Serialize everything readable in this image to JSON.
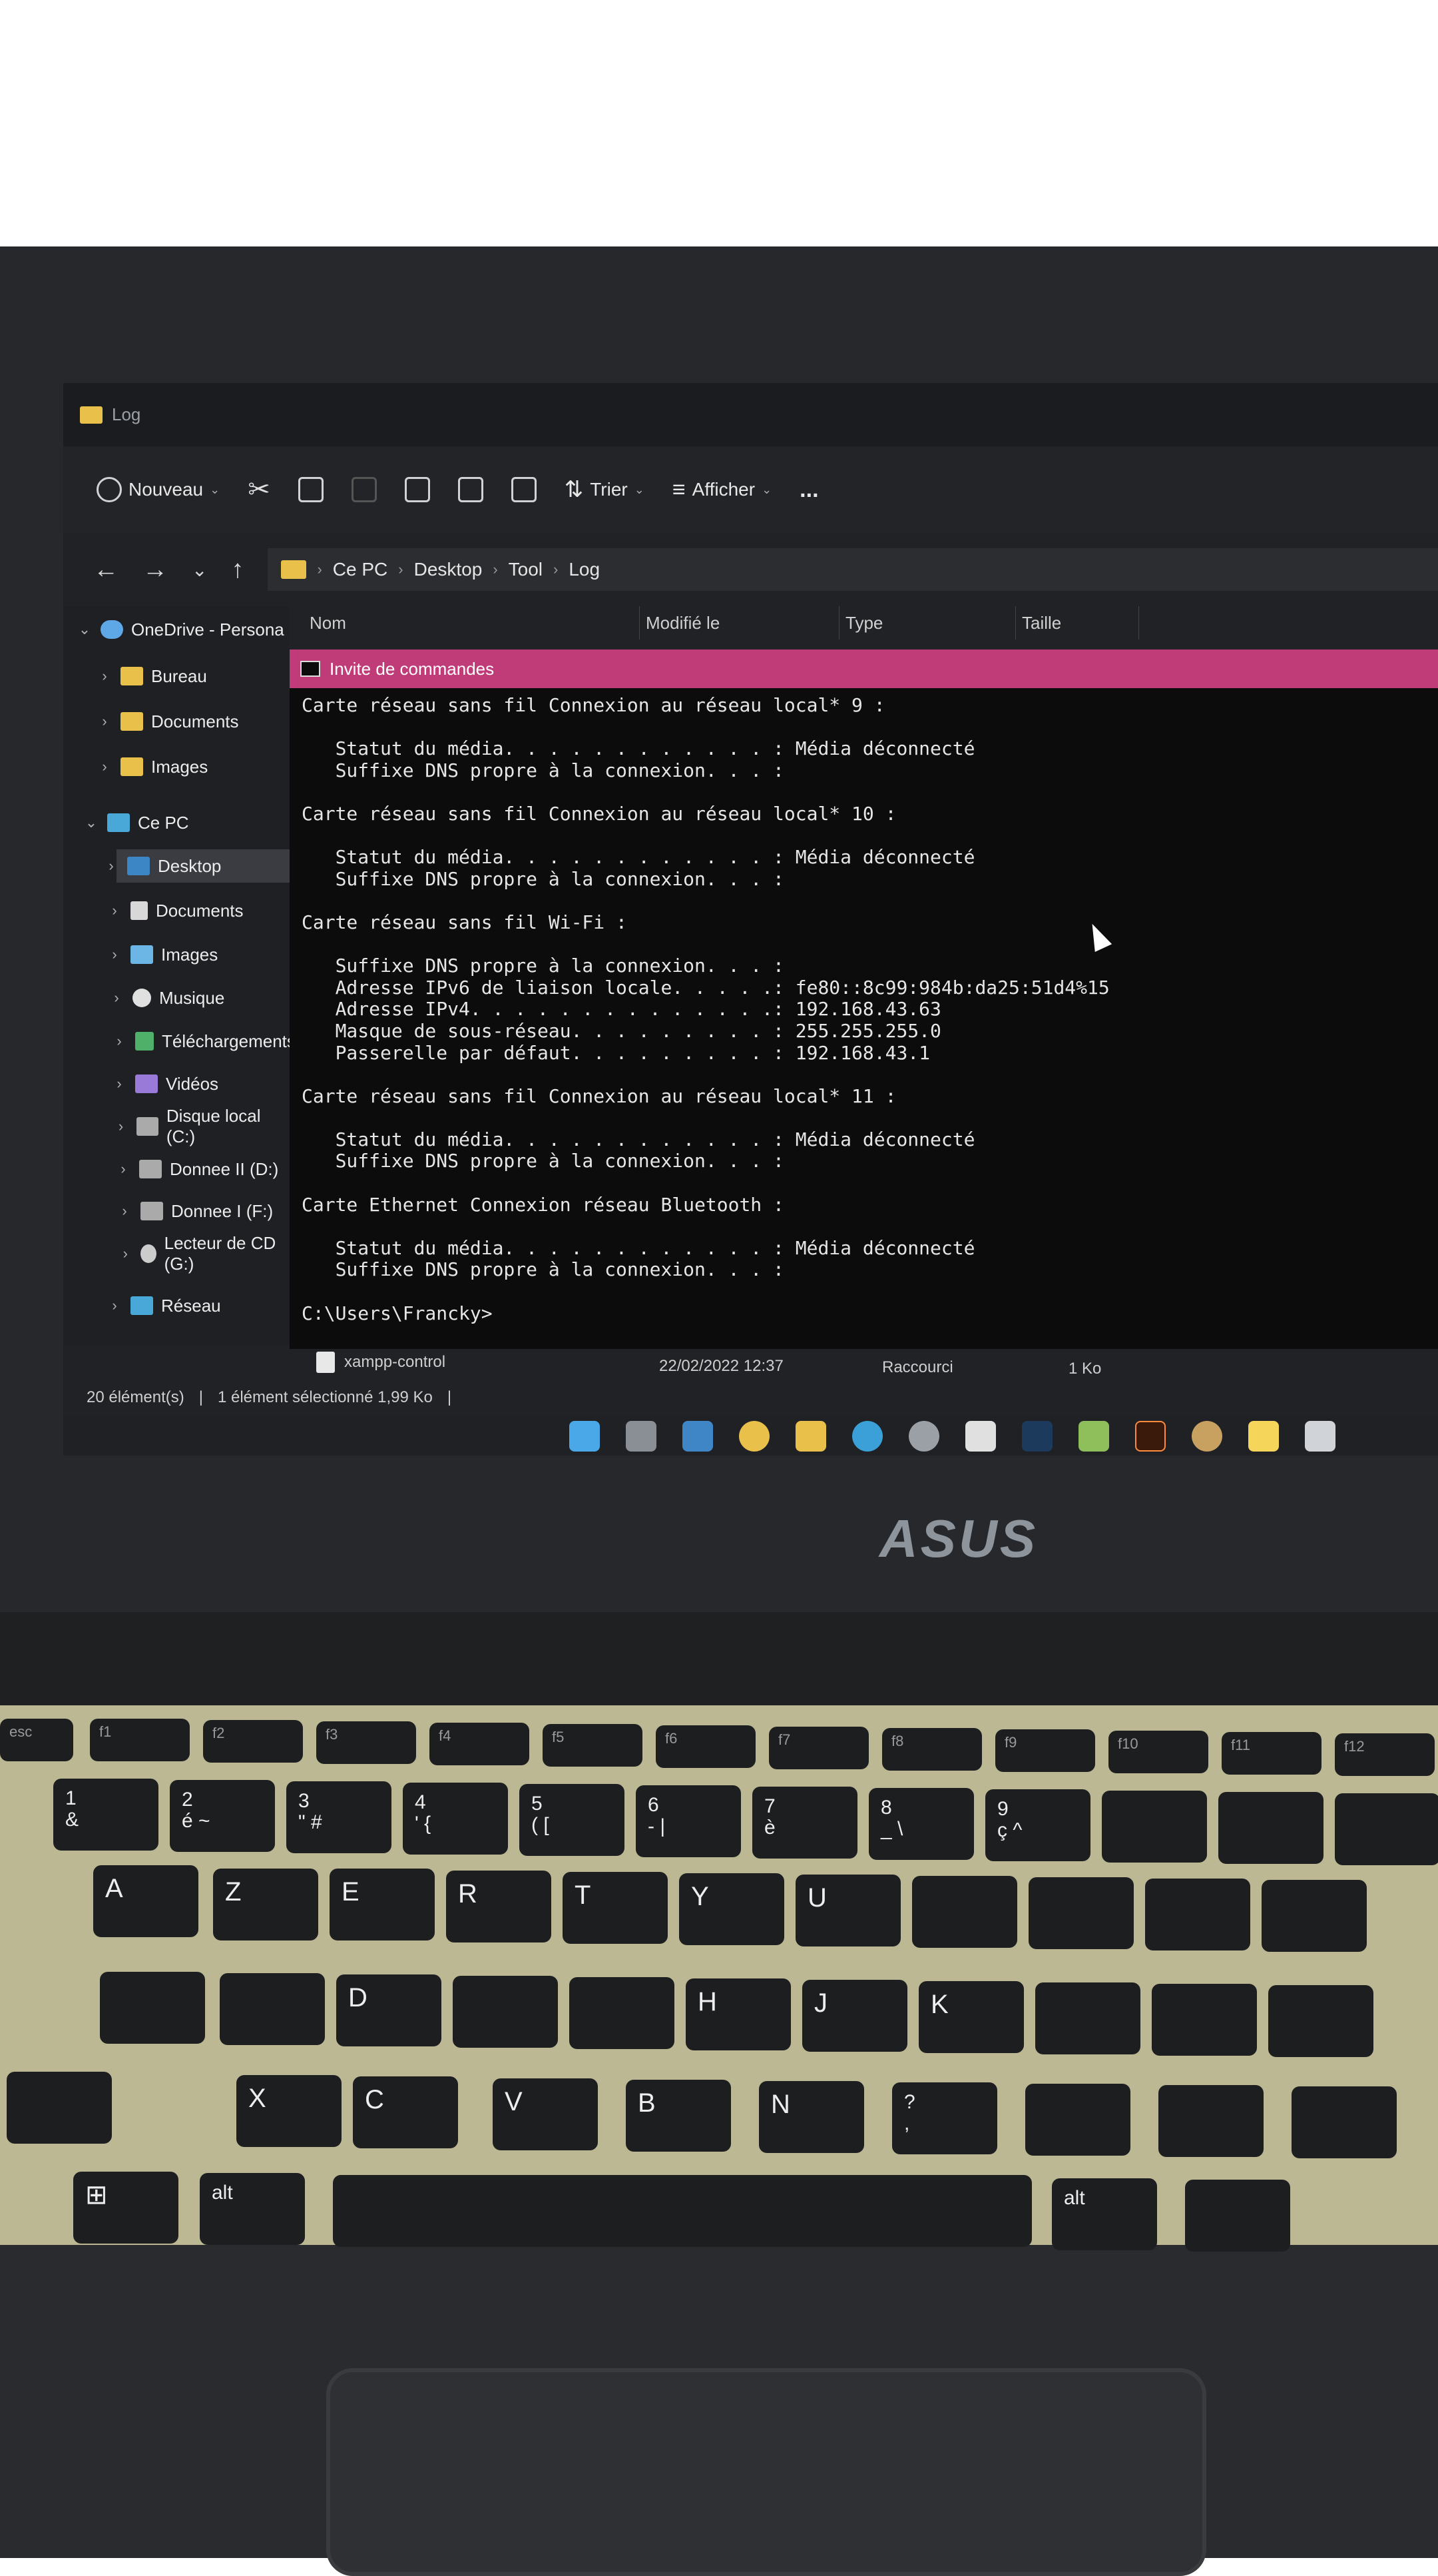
{
  "explorer": {
    "window_title": "Log",
    "toolbar": {
      "new_label": "Nouveau",
      "sort_label": "Trier",
      "view_label": "Afficher",
      "more_label": "..."
    },
    "breadcrumb": [
      "Ce PC",
      "Desktop",
      "Tool",
      "Log"
    ],
    "nav_pane": {
      "onedrive": "OneDrive - Persona",
      "bureau": "Bureau",
      "documents_od": "Documents",
      "images_od": "Images",
      "this_pc": "Ce PC",
      "desktop": "Desktop",
      "documents": "Documents",
      "images": "Images",
      "music": "Musique",
      "downloads": "Téléchargements",
      "videos": "Vidéos",
      "local_disk": "Disque local (C:)",
      "drive_d": "Donnee II (D:)",
      "drive_f": "Donnee I (F:)",
      "cd_drive": "Lecteur de CD (G:)",
      "network": "Réseau"
    },
    "columns": {
      "name": "Nom",
      "modified": "Modifié le",
      "type": "Type",
      "size": "Taille"
    },
    "file": {
      "name": "xampp-control",
      "modified": "22/02/2022 12:37",
      "type": "Raccourci",
      "size": "1 Ko"
    },
    "status": {
      "count": "20 élément(s)",
      "selection": "1 élément sélectionné 1,99 Ko"
    }
  },
  "cmd": {
    "title": "Invite de commandes",
    "output": "Carte réseau sans fil Connexion au réseau local* 9 :\n\n   Statut du média. . . . . . . . . . . . : Média déconnecté\n   Suffixe DNS propre à la connexion. . . :\n\nCarte réseau sans fil Connexion au réseau local* 10 :\n\n   Statut du média. . . . . . . . . . . . : Média déconnecté\n   Suffixe DNS propre à la connexion. . . :\n\nCarte réseau sans fil Wi-Fi :\n\n   Suffixe DNS propre à la connexion. . . :\n   Adresse IPv6 de liaison locale. . . . .: fe80::8c99:984b:da25:51d4%15\n   Adresse IPv4. . . . . . . . . . . . . .: 192.168.43.63\n   Masque de sous-réseau. . . . . . . . . : 255.255.255.0\n   Passerelle par défaut. . . . . . . . . : 192.168.43.1\n\nCarte réseau sans fil Connexion au réseau local* 11 :\n\n   Statut du média. . . . . . . . . . . . : Média déconnecté\n   Suffixe DNS propre à la connexion. . . :\n\nCarte Ethernet Connexion réseau Bluetooth :\n\n   Statut du média. . . . . . . . . . . . : Média déconnecté\n   Suffixe DNS propre à la connexion. . . :\n\nC:\\Users\\Francky>"
  },
  "laptop": {
    "brand": "ASUS"
  },
  "keyboard": {
    "esc": "esc",
    "f1": "f1",
    "f2": "f2",
    "f3": "f3",
    "f4": "f4",
    "f5": "f5",
    "f6": "f6",
    "f7": "f7",
    "f8": "f8",
    "f9": "f9",
    "f10": "f10",
    "f11": "f11",
    "f12": "f12",
    "k1": "1\n&",
    "k2": "2\né ~",
    "k3": "3\n\" #",
    "k4": "4\n' {",
    "k5": "5\n( [",
    "k6": "6\n- |",
    "k7": "7\nè",
    "k8": "8\n_ \\",
    "k9": "9\nç ^",
    "a": "A",
    "z": "Z",
    "e": "E",
    "r": "R",
    "t": "T",
    "y": "Y",
    "u": "U",
    "d": "D",
    "h": "H",
    "j": "J",
    "k": "K",
    "x": "X",
    "c": "C",
    "v": "V",
    "b": "B",
    "n": "N",
    "comma": "?\n,",
    "alt_left": "alt",
    "alt_right": "alt"
  }
}
